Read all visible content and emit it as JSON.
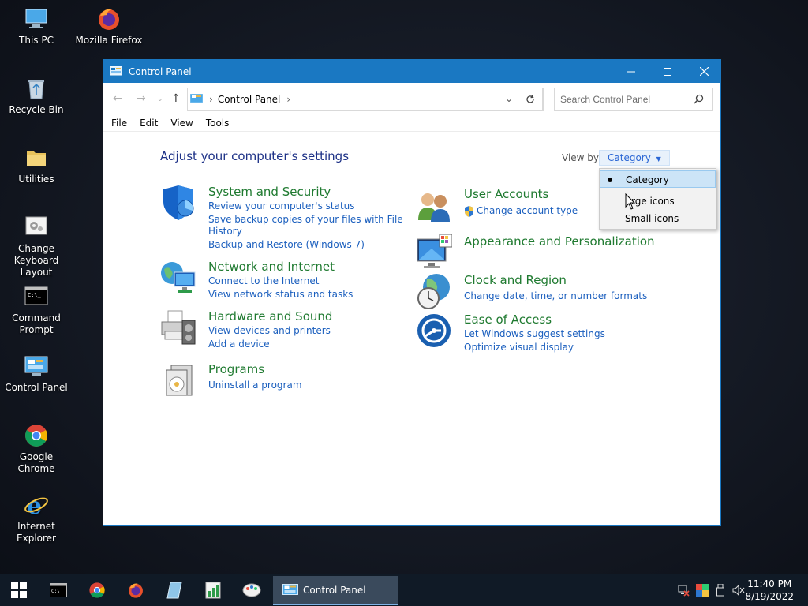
{
  "desktop": {
    "icons": [
      {
        "label": "This PC"
      },
      {
        "label": "Mozilla Firefox"
      },
      {
        "label": "Recycle Bin"
      },
      {
        "label": "Utilities"
      },
      {
        "label": "Change Keyboard Layout"
      },
      {
        "label": "Command Prompt"
      },
      {
        "label": "Control Panel"
      },
      {
        "label": "Google Chrome"
      },
      {
        "label": "Internet Explorer"
      }
    ]
  },
  "window": {
    "title": "Control Panel",
    "address": {
      "crumb": "Control Panel"
    },
    "search_placeholder": "Search Control Panel",
    "menu": [
      "File",
      "Edit",
      "View",
      "Tools"
    ],
    "heading": "Adjust your computer's settings",
    "view_by_label": "View by:",
    "view_by_value": "Category",
    "categories": [
      {
        "title": "System and Security",
        "icon": "shield-icon",
        "links": [
          "Review your computer's status",
          "Save backup copies of your files with File",
          "History",
          "Backup and Restore (Windows 7)"
        ]
      },
      {
        "title": "Network and Internet",
        "icon": "network-icon",
        "links": [
          "Connect to the Internet",
          "View network status and tasks"
        ]
      },
      {
        "title": "Hardware and Sound",
        "icon": "printer-icon",
        "links": [
          "View devices and printers",
          "Add a device"
        ]
      },
      {
        "title": "Programs",
        "icon": "programs-icon",
        "links": [
          "Uninstall a program"
        ]
      },
      {
        "title": "User Accounts",
        "icon": "users-icon",
        "links": [
          "Change account type"
        ]
      },
      {
        "title": "Appearance and Personalization",
        "icon": "monitor-icon",
        "links": []
      },
      {
        "title": "Clock and Region",
        "icon": "clock-globe-icon",
        "links": [
          "Change date, time, or number formats"
        ]
      },
      {
        "title": "Ease of Access",
        "icon": "ease-of-access-icon",
        "links": [
          "Let Windows suggest settings",
          "Optimize visual display"
        ]
      }
    ]
  },
  "dropdown": {
    "options": [
      {
        "label": "Category",
        "selected": true
      },
      {
        "label": "Large icons",
        "selected": false
      },
      {
        "label": "Small icons",
        "selected": false
      }
    ],
    "shown_label_1": "rge icons"
  },
  "taskbar": {
    "active_window": "Control Panel",
    "time": "11:40 PM",
    "date": "8/19/2022"
  },
  "colors": {
    "accent": "#1a78c2",
    "category_title": "#1f7a30",
    "link": "#1b5fbe",
    "heading": "#1e3287"
  }
}
